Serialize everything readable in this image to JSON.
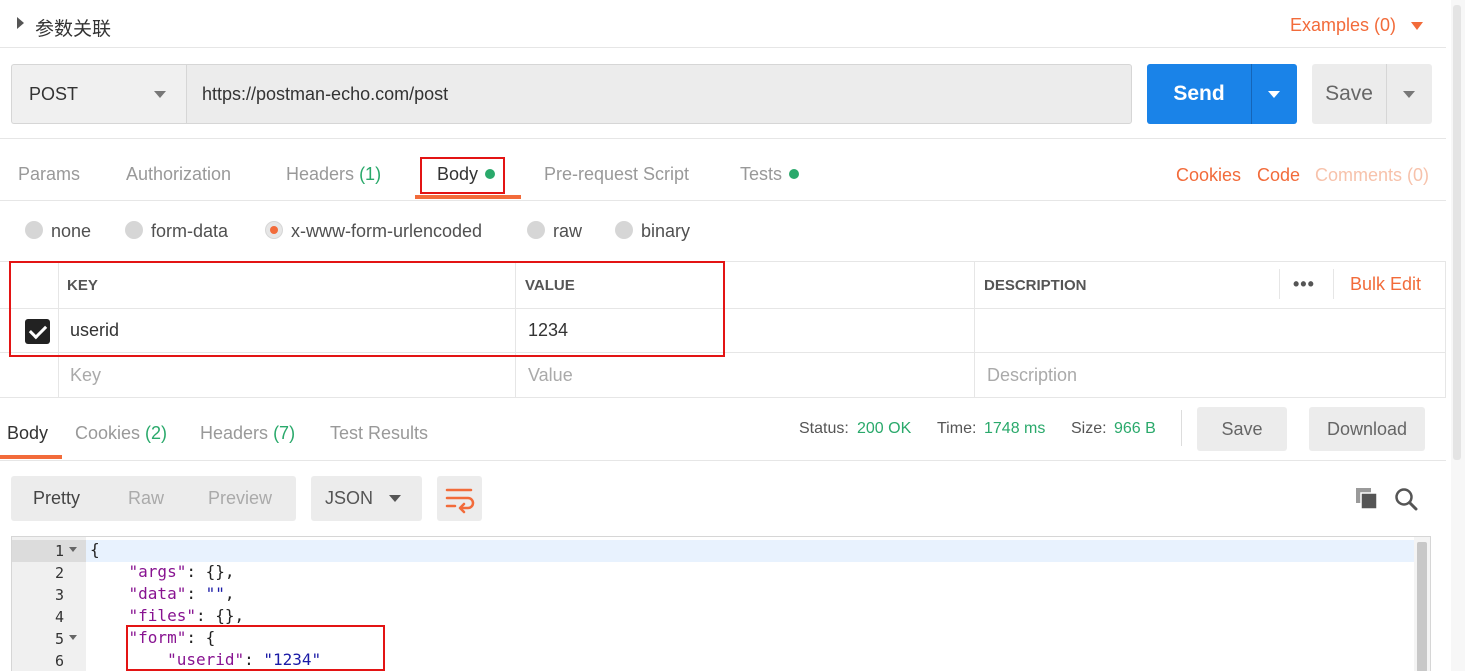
{
  "header": {
    "title": "参数关联",
    "examples_label": "Examples (0)"
  },
  "request": {
    "method": "POST",
    "url": "https://postman-echo.com/post",
    "send_label": "Send",
    "save_label": "Save"
  },
  "req_tabs": {
    "params": "Params",
    "authorization": "Authorization",
    "headers": "Headers",
    "headers_count": "(1)",
    "body": "Body",
    "prerequest": "Pre-request Script",
    "tests": "Tests",
    "cookies": "Cookies",
    "code": "Code",
    "comments": "Comments (0)"
  },
  "body_types": [
    "none",
    "form-data",
    "x-www-form-urlencoded",
    "raw",
    "binary"
  ],
  "body_type_selected": "x-www-form-urlencoded",
  "kv_table": {
    "headers": {
      "key": "KEY",
      "value": "VALUE",
      "description": "DESCRIPTION"
    },
    "more": "•••",
    "bulk_edit": "Bulk Edit",
    "rows": [
      {
        "checked": true,
        "key": "userid",
        "value": "1234",
        "description": ""
      }
    ],
    "placeholders": {
      "key": "Key",
      "value": "Value",
      "description": "Description"
    }
  },
  "response": {
    "tabs": {
      "body": "Body",
      "cookies": "Cookies",
      "cookies_count": "(2)",
      "headers": "Headers",
      "headers_count": "(7)",
      "test_results": "Test Results"
    },
    "status_label": "Status:",
    "status_value": "200 OK",
    "time_label": "Time:",
    "time_value": "1748 ms",
    "size_label": "Size:",
    "size_value": "966 B",
    "save_label": "Save",
    "download_label": "Download",
    "views": {
      "pretty": "Pretty",
      "raw": "Raw",
      "preview": "Preview"
    },
    "format": "JSON",
    "code_lines": [
      {
        "n": "1",
        "text": "{"
      },
      {
        "n": "2",
        "k": "\"args\"",
        "rest": ": {},"
      },
      {
        "n": "3",
        "k": "\"data\"",
        "rest": ": ",
        "s": "\"\"",
        "tail": ","
      },
      {
        "n": "4",
        "k": "\"files\"",
        "rest": ": {},"
      },
      {
        "n": "5",
        "k": "\"form\"",
        "rest": ": {"
      },
      {
        "n": "6",
        "k": "\"userid\"",
        "rest": ": ",
        "s": "\"1234\"",
        "tail": ""
      }
    ]
  },
  "colors": {
    "accent": "#f26b3a",
    "send": "#1a83e8",
    "success": "#2aa96b",
    "annotation": "#e31414"
  }
}
